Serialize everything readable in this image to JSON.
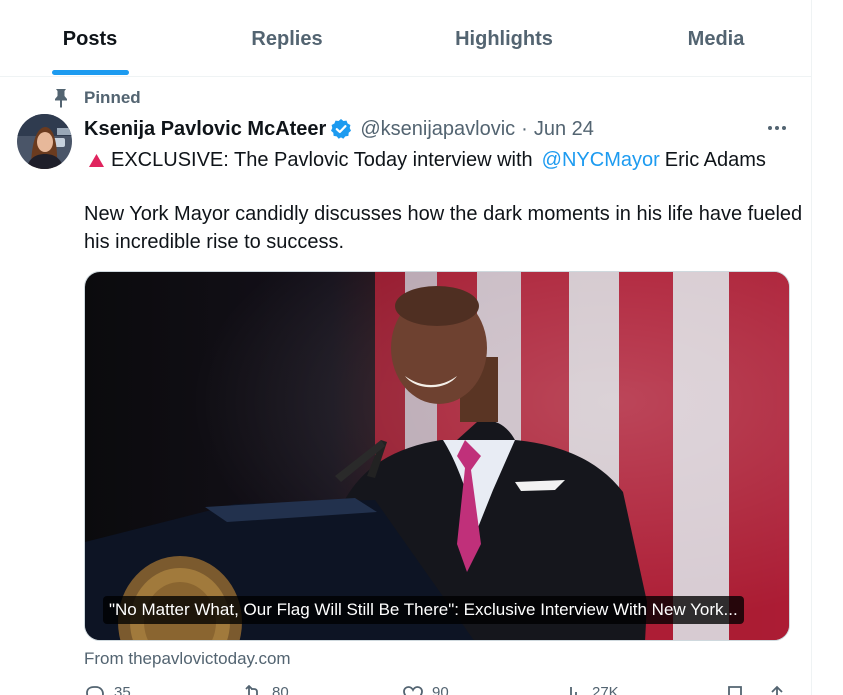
{
  "tabs": [
    {
      "label": "Posts",
      "active": true
    },
    {
      "label": "Replies",
      "active": false
    },
    {
      "label": "Highlights",
      "active": false
    },
    {
      "label": "Media",
      "active": false
    }
  ],
  "pinned_label": "Pinned",
  "post": {
    "author_name": "Ksenija Pavlovic McAteer",
    "handle": "@ksenijapavlovic",
    "separator": "·",
    "date": "Jun 24",
    "line1_prefix": "EXCLUSIVE: The Pavlovic Today interview with",
    "line1_mention": "@NYCMayor",
    "line1_suffix": "Eric Adams",
    "body": "New York Mayor candidly discusses how the dark moments in his life have fueled his incredible rise to success.",
    "card_caption": "\"No Matter What, Our Flag Will Still Be There\": Exclusive Interview With New York...",
    "card_source": "From thepavlovictoday.com",
    "counts": {
      "replies": "35",
      "reposts": "80",
      "likes": "90",
      "views": "27K"
    }
  },
  "icons": [
    "pin-icon",
    "verified-badge-icon",
    "more-icon",
    "red-triangle-icon",
    "reply-icon",
    "repost-icon",
    "like-icon",
    "views-icon",
    "bookmark-icon",
    "share-icon"
  ],
  "colors": {
    "accent": "#1d9bf0",
    "text": "#0f1419",
    "muted": "#536471",
    "triangle": "#e0245e"
  }
}
